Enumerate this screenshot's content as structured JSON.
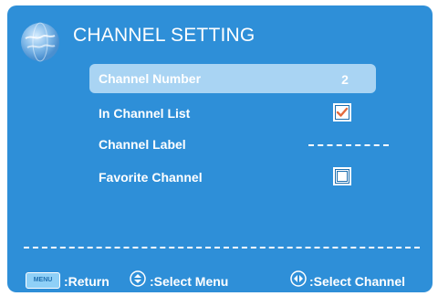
{
  "header": {
    "title": "CHANNEL SETTING",
    "icon": "globe-icon"
  },
  "menu": {
    "items": [
      {
        "label": "Channel Number",
        "value": "2",
        "selected": true
      },
      {
        "label": "In Channel List",
        "checked": true
      },
      {
        "label": "Channel Label",
        "value_placeholder": "------"
      },
      {
        "label": "Favorite Channel",
        "checked": false
      }
    ]
  },
  "footer": {
    "menu_key": "MENU",
    "return_label": ":Return",
    "select_menu_label": ":Select Menu",
    "select_channel_label": ":Select Channel"
  },
  "colors": {
    "background": "#2e8fd8",
    "highlight": "#a9d4f3",
    "check": "#e36a3d"
  }
}
